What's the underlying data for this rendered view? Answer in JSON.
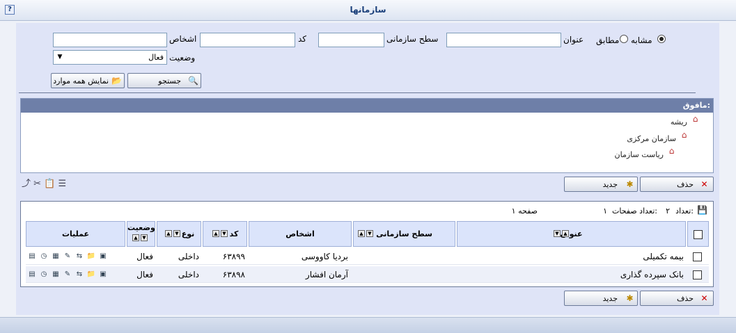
{
  "window": {
    "title": "سازمانها",
    "help": "?"
  },
  "filters": {
    "title_label": "عنوان",
    "match_similar": "مشابه",
    "match_exact": "مطابق",
    "org_level_label": "سطح سازمانی",
    "code_label": "کد",
    "persons_label": "اشخاص",
    "status_label": "وضعیت",
    "status_value": "فعال",
    "search_button": "جستجو",
    "show_all_button": "نمایش همه موارد"
  },
  "tree": {
    "header": "مافوق:",
    "nodes": [
      "ریشه",
      "سازمان مرکزی",
      "ریاست سازمان"
    ]
  },
  "actions": {
    "delete": "حذف",
    "new": "جدید"
  },
  "grid": {
    "count_label": "تعداد:",
    "count_value": "۲",
    "pages_label": "تعداد صفحات:",
    "pages_value": "۱",
    "page_label": "صفحه ۱",
    "columns": {
      "title": "عنوان",
      "org_level": "سطح سازمانی",
      "persons": "اشخاص",
      "code": "کد",
      "type": "نوع",
      "status": "وضعیت",
      "ops": "عملیات"
    },
    "rows": [
      {
        "title": "بیمه تکمیلی",
        "org_level": "",
        "persons": "بردیا کاووسی",
        "code": "۶۳۸۹۹",
        "type": "داخلی",
        "status": "فعال"
      },
      {
        "title": "بانک سپرده گذاری",
        "org_level": "",
        "persons": "آرمان افشار",
        "code": "۶۳۸۹۸",
        "type": "داخلی",
        "status": "فعال"
      }
    ]
  },
  "icons": [
    "help-icon",
    "search-icon",
    "show-all-icon",
    "house-icon",
    "move-up-icon",
    "cut-icon",
    "paste-icon",
    "tree-icon",
    "save-icon",
    "delete-icon",
    "new-icon",
    "edit-icon",
    "open-icon",
    "report-icon",
    "history-icon",
    "doc-icon",
    "grid-icon",
    "settings-icon"
  ]
}
